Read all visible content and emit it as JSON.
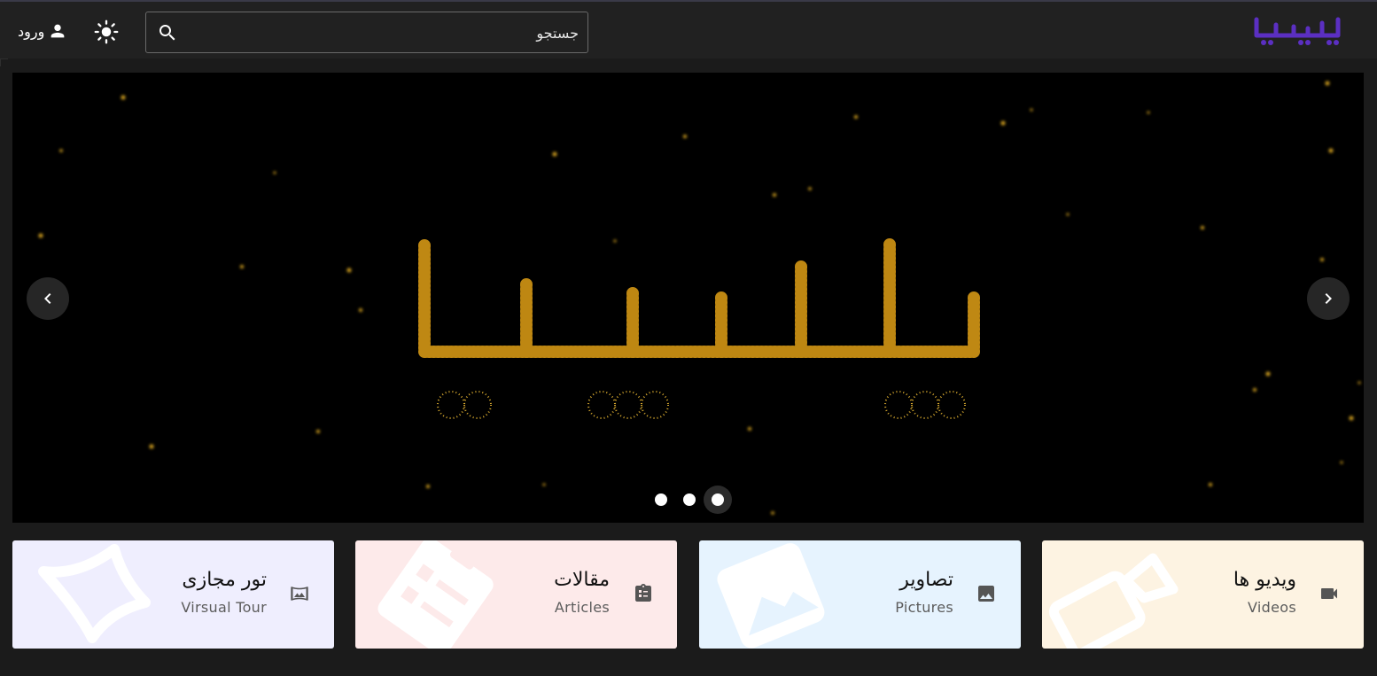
{
  "header": {
    "login_label": "ورود",
    "search": {
      "placeholder": "جستجو"
    }
  },
  "carousel": {
    "slide_count": 3,
    "active_slide": 3
  },
  "cards": [
    {
      "title": "ویدیو ها",
      "subtitle": "Videos",
      "icon": "videocam-icon",
      "color": "#fdf3e2"
    },
    {
      "title": "تصاویر",
      "subtitle": "Pictures",
      "icon": "image-icon",
      "color": "#e6f3fe"
    },
    {
      "title": "مقالات",
      "subtitle": "Articles",
      "icon": "assignment-icon",
      "color": "#fdeaea"
    },
    {
      "title": "تور مجازی",
      "subtitle": "Virsual Tour",
      "icon": "panorama-icon",
      "color": "#efeefe"
    }
  ],
  "colors": {
    "header_bg": "#212121",
    "logo": "#5b2fc2",
    "sparkle": "#d9a520"
  }
}
